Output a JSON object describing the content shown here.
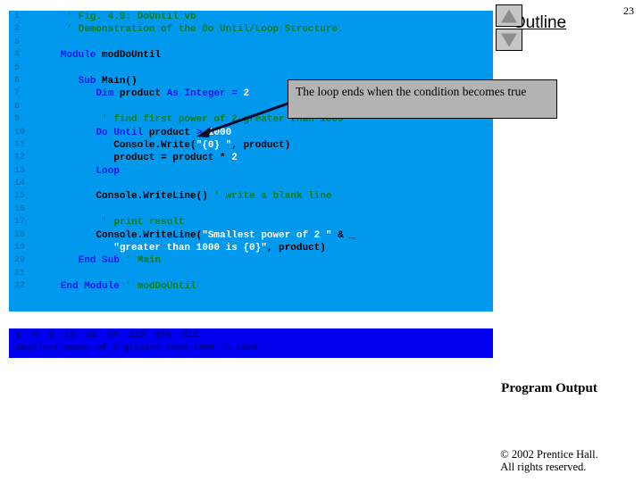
{
  "page": {
    "number": "23",
    "outline_title": "Outline",
    "background_color": "#ffffff"
  },
  "scroll_buttons": {
    "up_icon": "triangle-up-icon",
    "down_icon": "triangle-down-icon"
  },
  "code_listing": {
    "background_color": "#0099ee",
    "line_number_color": "#0077bb",
    "keyword_color": "#1818ee",
    "identifier_color": "#000000",
    "comment_color": "#007d1c",
    "lines": [
      {
        "n": "1",
        "tokens": [
          {
            "t": "cm",
            "v": "    ' Fig. 4.9: DoUntil.vb"
          }
        ]
      },
      {
        "n": "2",
        "tokens": [
          {
            "t": "cm",
            "v": "    ' Demonstration of the Do Until/Loop Structure."
          }
        ]
      },
      {
        "n": "3",
        "tokens": [
          {
            "t": "id",
            "v": ""
          }
        ]
      },
      {
        "n": "4",
        "tokens": [
          {
            "t": "kw",
            "v": "   Module "
          },
          {
            "t": "id",
            "v": "modDoUntil"
          }
        ]
      },
      {
        "n": "5",
        "tokens": [
          {
            "t": "id",
            "v": ""
          }
        ]
      },
      {
        "n": "6",
        "tokens": [
          {
            "t": "kw",
            "v": "      Sub "
          },
          {
            "t": "id",
            "v": "Main()"
          }
        ]
      },
      {
        "n": "7",
        "tokens": [
          {
            "t": "kw",
            "v": "         Dim "
          },
          {
            "t": "id",
            "v": "product "
          },
          {
            "t": "kw",
            "v": "As Integer = "
          },
          {
            "t": "num",
            "v": "2"
          }
        ]
      },
      {
        "n": "8",
        "tokens": [
          {
            "t": "id",
            "v": ""
          }
        ]
      },
      {
        "n": "9",
        "tokens": [
          {
            "t": "cm",
            "v": "          ' find first power of 2 greater than 1000"
          }
        ]
      },
      {
        "n": "10",
        "tokens": [
          {
            "t": "kw",
            "v": "         Do Until "
          },
          {
            "t": "id",
            "v": "product "
          },
          {
            "t": "kw",
            "v": "> "
          },
          {
            "t": "num",
            "v": "1000"
          }
        ]
      },
      {
        "n": "11",
        "tokens": [
          {
            "t": "id",
            "v": "            Console.Write("
          },
          {
            "t": "str",
            "v": "\"{0} \""
          },
          {
            "t": "id",
            "v": ", product)"
          }
        ]
      },
      {
        "n": "12",
        "tokens": [
          {
            "t": "id",
            "v": "            product = product * "
          },
          {
            "t": "num",
            "v": "2"
          }
        ]
      },
      {
        "n": "13",
        "tokens": [
          {
            "t": "kw",
            "v": "         Loop"
          }
        ]
      },
      {
        "n": "14",
        "tokens": [
          {
            "t": "id",
            "v": ""
          }
        ]
      },
      {
        "n": "15",
        "tokens": [
          {
            "t": "id",
            "v": "         Console.WriteLine() "
          },
          {
            "t": "cm",
            "v": "' write a blank line"
          }
        ]
      },
      {
        "n": "16",
        "tokens": [
          {
            "t": "id",
            "v": ""
          }
        ]
      },
      {
        "n": "17",
        "tokens": [
          {
            "t": "cm",
            "v": "          ' print result"
          }
        ]
      },
      {
        "n": "18",
        "tokens": [
          {
            "t": "id",
            "v": "         Console.WriteLine("
          },
          {
            "t": "str",
            "v": "\"Smallest power of 2 \" "
          },
          {
            "t": "id",
            "v": "& _"
          }
        ]
      },
      {
        "n": "19",
        "tokens": [
          {
            "t": "str",
            "v": "            \"greater than 1000 is {0}\""
          },
          {
            "t": "id",
            "v": ", product)"
          }
        ]
      },
      {
        "n": "20",
        "tokens": [
          {
            "t": "kw",
            "v": "      End Sub "
          },
          {
            "t": "cm",
            "v": "' Main"
          }
        ]
      },
      {
        "n": "21",
        "tokens": [
          {
            "t": "id",
            "v": ""
          }
        ]
      },
      {
        "n": "22",
        "tokens": [
          {
            "t": "kw",
            "v": "   End Module "
          },
          {
            "t": "cm",
            "v": "' modDoUntil"
          }
        ]
      }
    ]
  },
  "callout": {
    "text": "The loop ends when the condition becomes true",
    "background_color": "#b3b3b3",
    "border_color": "#000000"
  },
  "outline_filename_fragment": ". vb",
  "console_output": {
    "background_color": "#0000ee",
    "text_color": "#000080",
    "lines": [
      "2  4  8  16  32  64  128  256  512",
      "Smallest power of 2 greater than 1000 is 1024"
    ]
  },
  "labels": {
    "program_output": "Program Output",
    "copyright_line1": "© 2002 Prentice Hall.",
    "copyright_line2": "All rights reserved."
  }
}
